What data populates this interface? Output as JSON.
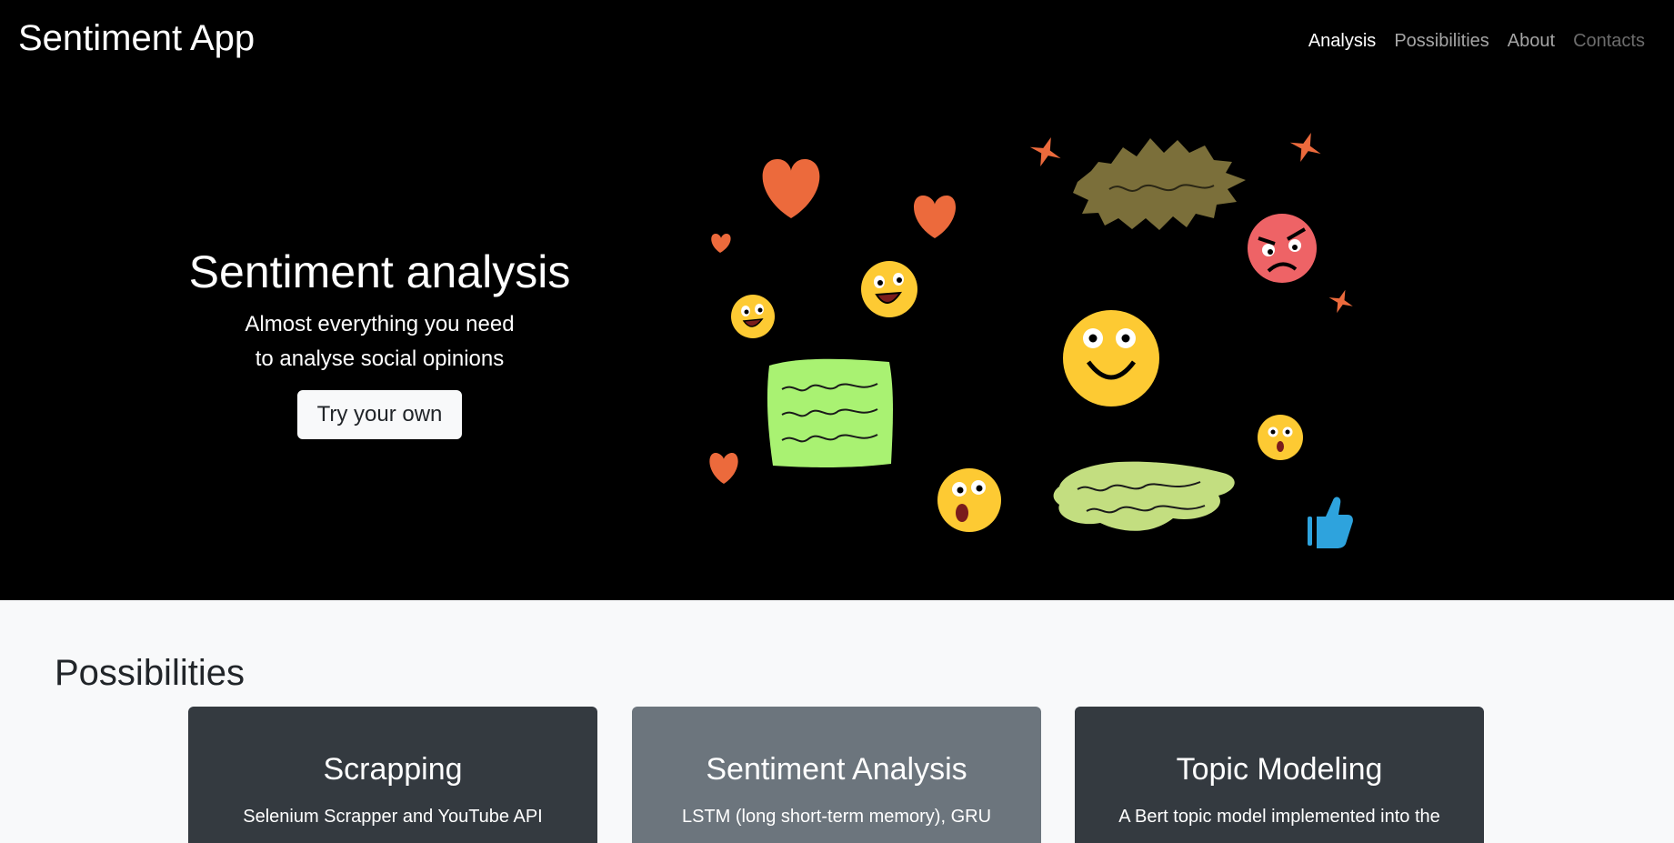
{
  "app": {
    "brand": "Sentiment App"
  },
  "nav": {
    "items": [
      {
        "label": "Analysis",
        "state": "active"
      },
      {
        "label": "Possibilities",
        "state": "muted"
      },
      {
        "label": "About",
        "state": "muted"
      },
      {
        "label": "Contacts",
        "state": "dim"
      }
    ]
  },
  "hero": {
    "title": "Sentiment analysis",
    "subtitle_line1": "Almost everything you need",
    "subtitle_line2": "to analyse social opinions",
    "cta_label": "Try your own"
  },
  "possibilities": {
    "title": "Possibilities",
    "cards": [
      {
        "title": "Scrapping",
        "text": "Selenium Scrapper and YouTube API",
        "style": "dark"
      },
      {
        "title": "Sentiment Analysis",
        "text": "LSTM (long short-term memory), GRU",
        "style": "gray"
      },
      {
        "title": "Topic Modeling",
        "text": "A Bert topic model implemented into the",
        "style": "dark"
      }
    ]
  },
  "colors": {
    "hero_bg": "#000000",
    "page_bg": "#f8f9fa",
    "card_dark": "#343a40",
    "card_gray": "#6c757d",
    "heart": "#ec6a3c",
    "emoji_yellow": "#fdca33",
    "angry_red": "#ee6366",
    "thumbs_blue": "#2ea3dd",
    "bubble_green": "#a9f272",
    "bubble_lightgreen": "#c3de80",
    "bubble_olive": "#7b6f3a"
  },
  "icons": [
    "heart-icon",
    "smile-emoji-icon",
    "laugh-emoji-icon",
    "surprised-emoji-icon",
    "angry-emoji-icon",
    "sparkle-icon",
    "thumbs-up-icon",
    "speech-bubble-icon"
  ]
}
